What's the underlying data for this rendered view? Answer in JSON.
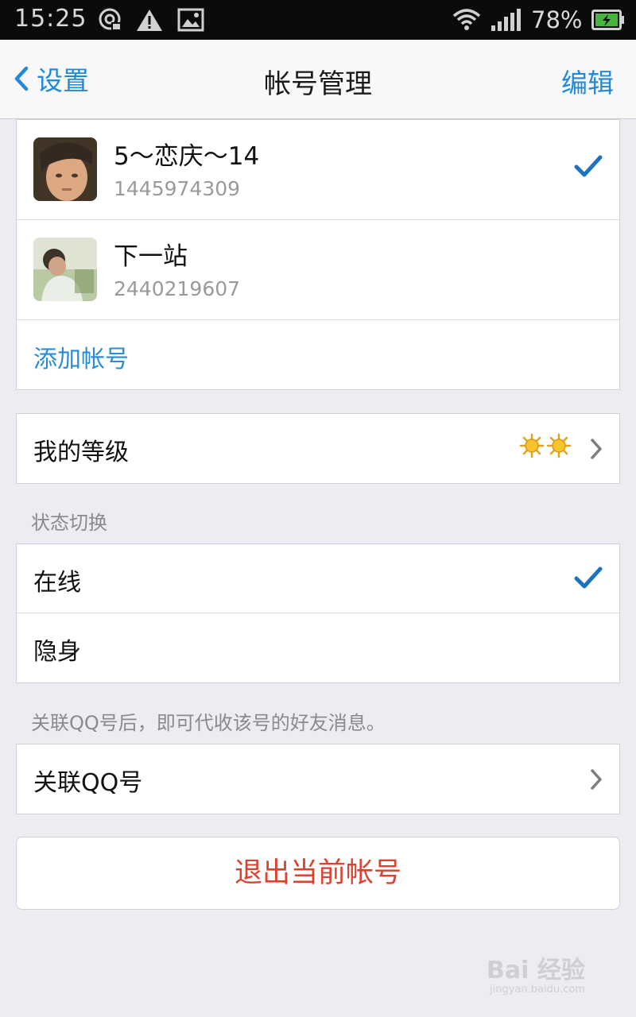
{
  "status_bar": {
    "time": "15:25",
    "battery_percent": "78%",
    "icons": [
      "sync-icon",
      "warning-icon",
      "image-icon",
      "wifi-icon",
      "signal-icon",
      "battery-icon"
    ]
  },
  "header": {
    "back_label": "设置",
    "title": "帐号管理",
    "edit_label": "编辑"
  },
  "accounts": [
    {
      "name": "5～恋庆～14",
      "number": "1445974309",
      "selected": true
    },
    {
      "name": "下一站",
      "number": "2440219607",
      "selected": false
    }
  ],
  "add_account_label": "添加帐号",
  "level": {
    "label": "我的等级",
    "icon": "sun-icon",
    "icon_count": 2
  },
  "status_section": {
    "caption": "状态切换",
    "options": [
      {
        "label": "在线",
        "selected": true
      },
      {
        "label": "隐身",
        "selected": false
      }
    ]
  },
  "link_section": {
    "caption": "关联QQ号后，即可代收该号的好友消息。",
    "label": "关联QQ号"
  },
  "logout_label": "退出当前帐号",
  "watermark": {
    "main": "Bai 经验",
    "sub": "jingyan.baidu.com"
  },
  "colors": {
    "accent": "#1f8ad8",
    "check": "#1a72c0",
    "danger": "#d9432f",
    "background": "#ebedf2"
  }
}
